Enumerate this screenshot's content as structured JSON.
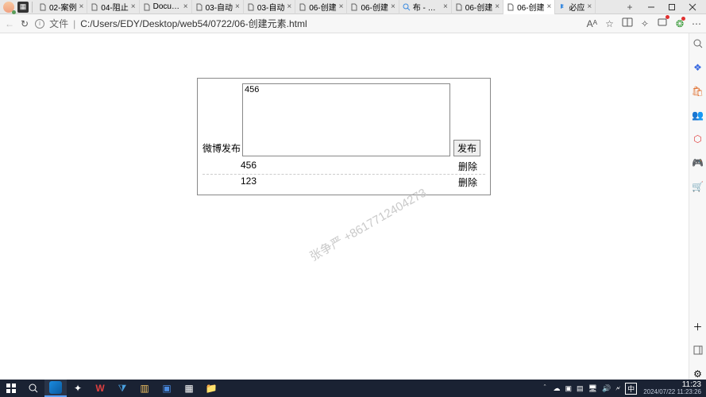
{
  "titlebar": {
    "tabs": [
      {
        "icon": "file",
        "label": "02-案例",
        "close": "×"
      },
      {
        "icon": "file",
        "label": "04-阻止",
        "close": "×"
      },
      {
        "icon": "file",
        "label": "Docume",
        "close": "×"
      },
      {
        "icon": "file",
        "label": "03-自动",
        "close": "×"
      },
      {
        "icon": "file",
        "label": "03-自动",
        "close": "×"
      },
      {
        "icon": "file",
        "label": "06-创建",
        "close": "×"
      },
      {
        "icon": "file",
        "label": "06-创建",
        "close": "×"
      },
      {
        "icon": "search",
        "label": "布 - 搜索",
        "close": "×"
      },
      {
        "icon": "file",
        "label": "06-创建",
        "close": "×"
      },
      {
        "icon": "file",
        "label": "06-创建",
        "close": "×",
        "active": true
      },
      {
        "icon": "bing",
        "label": "必应",
        "close": "×"
      }
    ],
    "newtab": "+",
    "win": {
      "min": "–",
      "max": "▢",
      "close": "✕"
    }
  },
  "urlbar": {
    "back": "←",
    "reload": "↻",
    "proto": "文件",
    "divider": "|",
    "path": "C:/Users/EDY/Desktop/web54/0722/06-创建元素.html",
    "aa": "Aᴬ"
  },
  "page": {
    "publish_label": "微博发布",
    "textarea_value": "456",
    "publish_btn": "发布",
    "items": [
      {
        "text": "456",
        "del": "删除"
      },
      {
        "text": "123",
        "del": "删除"
      }
    ]
  },
  "watermark": "张争严 +8617712404273",
  "taskbar": {
    "ime": "中",
    "time": "11:23",
    "date": "2024/07/22 11:23:26"
  }
}
